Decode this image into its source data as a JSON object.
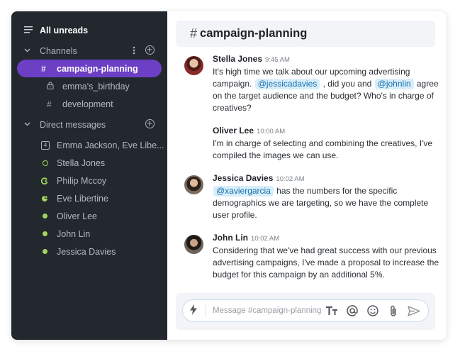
{
  "sidebar": {
    "all_unreads": "All unreads",
    "channels_title": "Channels",
    "channels": [
      {
        "label": "campaign-planning",
        "icon": "hash-icon",
        "active": true
      },
      {
        "label": "emma's_birthday",
        "icon": "lock-icon",
        "active": false
      },
      {
        "label": "development",
        "icon": "hash-icon",
        "active": false
      }
    ],
    "dm_title": "Direct messages",
    "dms": [
      {
        "label": "Emma Jackson, Eve Libe...",
        "status": "group",
        "count": "4"
      },
      {
        "label": "Stella Jones",
        "status": "away"
      },
      {
        "label": "Philip Mccoy",
        "status": "partial"
      },
      {
        "label": "Eve Libertine",
        "status": "partial"
      },
      {
        "label": "Oliver Lee",
        "status": "online"
      },
      {
        "label": "John Lin",
        "status": "online"
      },
      {
        "label": "Jessica Davies",
        "status": "online"
      }
    ]
  },
  "channel": {
    "name": "campaign-planning"
  },
  "messages": [
    {
      "author": "Stella Jones",
      "time": "9:45 AM",
      "parts": [
        {
          "t": "It's high time we talk about our upcoming advertising campaign. "
        },
        {
          "m": "@jessicadavies"
        },
        {
          "t": " , did you and "
        },
        {
          "m": "@johnlin"
        },
        {
          "t": " agree on the target audience and the budget? Who's in charge of creatives?"
        }
      ]
    },
    {
      "author": "Oliver Lee",
      "time": "10:00 AM",
      "parts": [
        {
          "t": "I'm in charge of selecting and combining the creatives, I've compiled the images we can use."
        }
      ]
    },
    {
      "author": "Jessica Davies",
      "time": "10:02 AM",
      "parts": [
        {
          "m": "@xaviergarcia"
        },
        {
          "t": " has the numbers for the specific demographics we are targeting, so we have the complete user profile."
        }
      ]
    },
    {
      "author": "John Lin",
      "time": "10:02 AM",
      "parts": [
        {
          "t": "Considering that we've had great success with our previous advertising campaigns, I've made a proposal to increase the budget for this campaign by an additional 5%."
        }
      ]
    }
  ],
  "composer": {
    "placeholder": "Message #campaign-planning"
  },
  "colors": {
    "sidebar_bg": "#22282e",
    "active_channel": "#6c3fc5",
    "online": "#a3d65c",
    "mention_bg": "#d6eefc"
  }
}
